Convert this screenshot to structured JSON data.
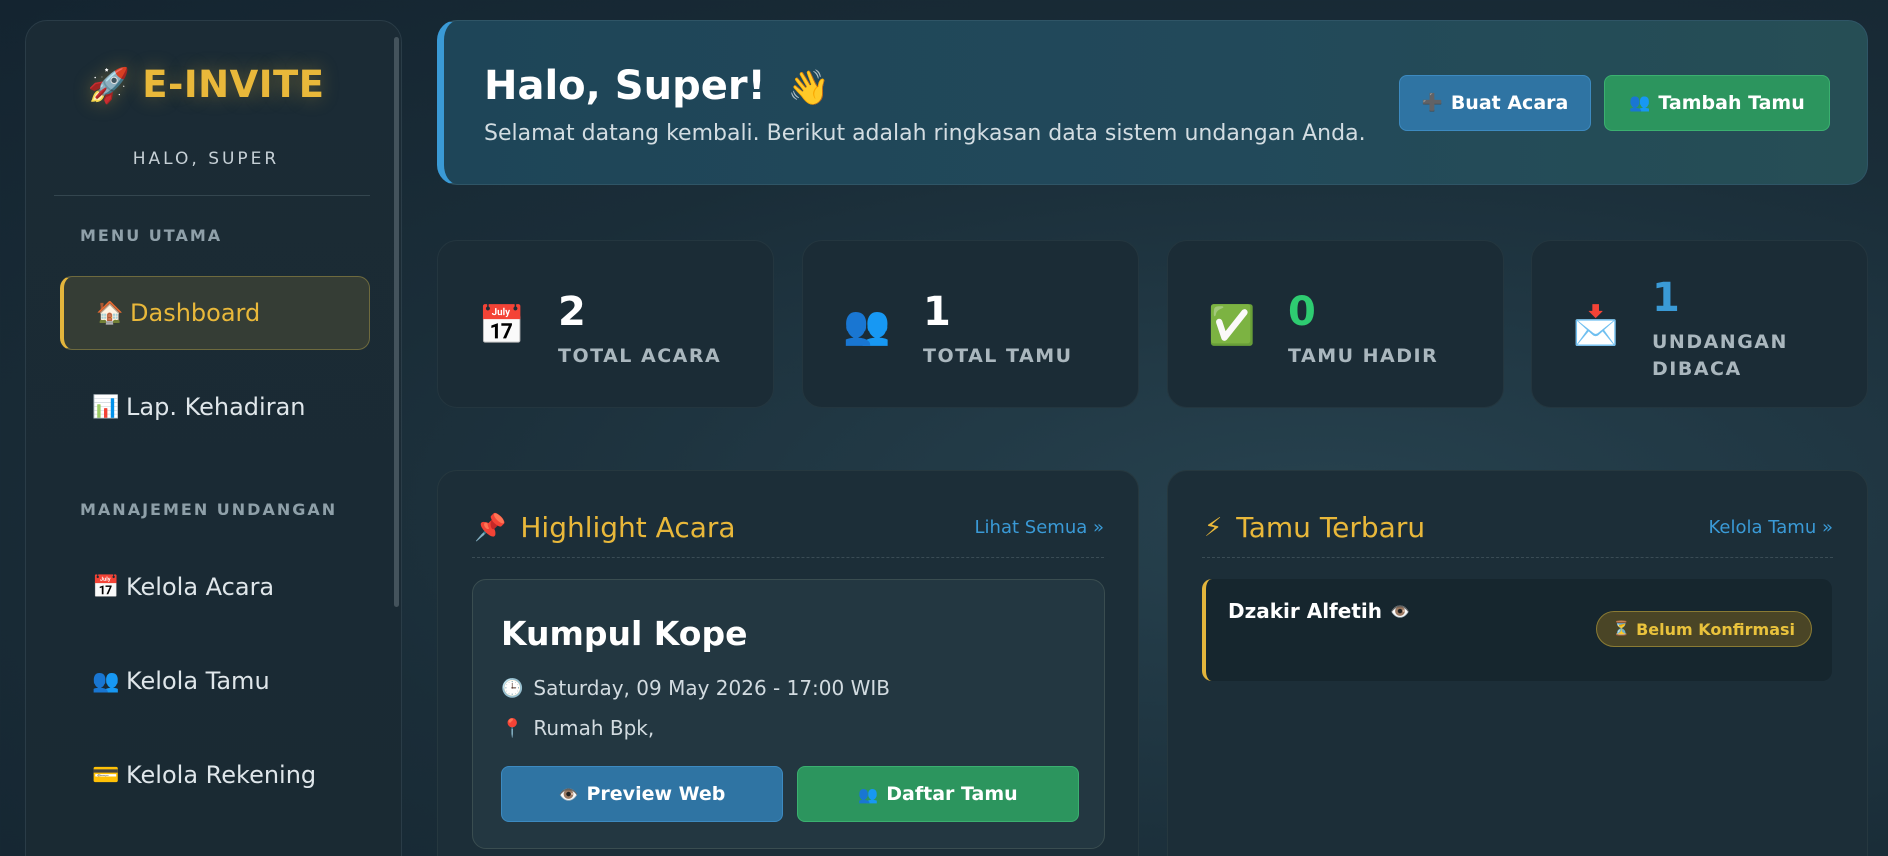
{
  "sidebar": {
    "brand": "E-INVITE",
    "brand_icon": "🚀",
    "greeting": "HALO, SUPER",
    "sections": [
      "MENU UTAMA",
      "MANAJEMEN UNDANGAN"
    ],
    "items": [
      {
        "icon": "🏠",
        "label": "Dashboard",
        "active": true
      },
      {
        "icon": "📊",
        "label": "Lap. Kehadiran"
      },
      {
        "icon": "📅",
        "label": "Kelola Acara"
      },
      {
        "icon": "👥",
        "label": "Kelola Tamu"
      },
      {
        "icon": "💳",
        "label": "Kelola Rekening"
      }
    ]
  },
  "header": {
    "title": "Halo, Super!",
    "wave_icon": "👋",
    "subtitle": "Selamat datang kembali. Berikut adalah ringkasan data sistem undangan Anda.",
    "buttons": [
      {
        "icon": "➕",
        "label": "Buat Acara"
      },
      {
        "icon": "👥",
        "label": "Tambah Tamu"
      }
    ]
  },
  "stats": [
    {
      "icon": "📅",
      "value": "2",
      "label": "TOTAL ACARA",
      "color": "#ffffff"
    },
    {
      "icon": "👥",
      "value": "1",
      "label": "TOTAL TAMU",
      "color": "#ffffff"
    },
    {
      "icon": "✅",
      "value": "0",
      "label": "TAMU HADIR",
      "color": "#2ecc71"
    },
    {
      "icon": "📩",
      "value": "1",
      "label": "UNDANGAN DIBACA",
      "color": "#3a9ad6"
    }
  ],
  "highlight": {
    "icon": "📌",
    "title": "Highlight Acara",
    "link": "Lihat Semua »",
    "event": {
      "name": "Kumpul Kope",
      "datetime_icon": "🕒",
      "datetime": "Saturday, 09 May 2026 - 17:00 WIB",
      "location_icon": "📍",
      "location": "Rumah Bpk,",
      "preview_icon": "👁️",
      "preview_label": "Preview Web",
      "guests_icon": "👥",
      "guests_label": "Daftar Tamu"
    }
  },
  "recent_guests": {
    "icon": "⚡",
    "title": "Tamu Terbaru",
    "link": "Kelola Tamu »",
    "guests": [
      {
        "name": "Dzakir Alfetih",
        "seen_icon": "👁️",
        "badge_icon": "⏳",
        "status": "Belum Konfirmasi"
      }
    ]
  },
  "colors": {
    "accent": "#e9b83a",
    "primary": "#3a9ad6",
    "success": "#2c955e"
  }
}
